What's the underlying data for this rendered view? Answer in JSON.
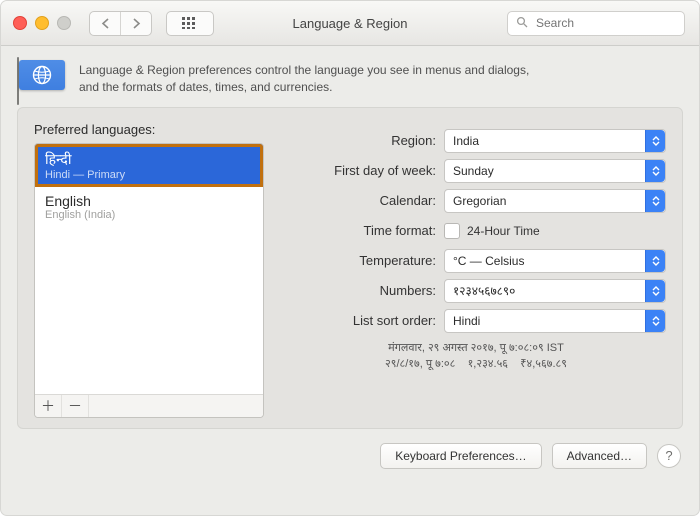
{
  "window": {
    "title": "Language & Region"
  },
  "search": {
    "placeholder": "Search"
  },
  "intro": {
    "line1": "Language & Region preferences control the language you see in menus and dialogs,",
    "line2": "and the formats of dates, times, and currencies."
  },
  "left": {
    "heading": "Preferred languages:",
    "items": [
      {
        "native": "हिन्दी",
        "detail": "Hindi — Primary",
        "selected": true
      },
      {
        "native": "English",
        "detail": "English (India)",
        "selected": false
      }
    ]
  },
  "settings": {
    "region": {
      "label": "Region:",
      "value": "India"
    },
    "first_day": {
      "label": "First day of week:",
      "value": "Sunday"
    },
    "calendar": {
      "label": "Calendar:",
      "value": "Gregorian"
    },
    "time_format": {
      "label": "Time format:",
      "value": "24-Hour Time",
      "checked": false
    },
    "temperature": {
      "label": "Temperature:",
      "value": "°C — Celsius"
    },
    "numbers": {
      "label": "Numbers:",
      "value": "१२३४५६७८९०"
    },
    "sort_order": {
      "label": "List sort order:",
      "value": "Hindi"
    }
  },
  "samples": {
    "line1": "मंगलवार, २९ अगस्त २०१७, पू ७:०८:०९ IST",
    "line2": "२९/८/१७, पू ७:०८    १,२३४.५६    ₹४,५६७.८९"
  },
  "footer": {
    "keyboard": "Keyboard Preferences…",
    "advanced": "Advanced…"
  }
}
